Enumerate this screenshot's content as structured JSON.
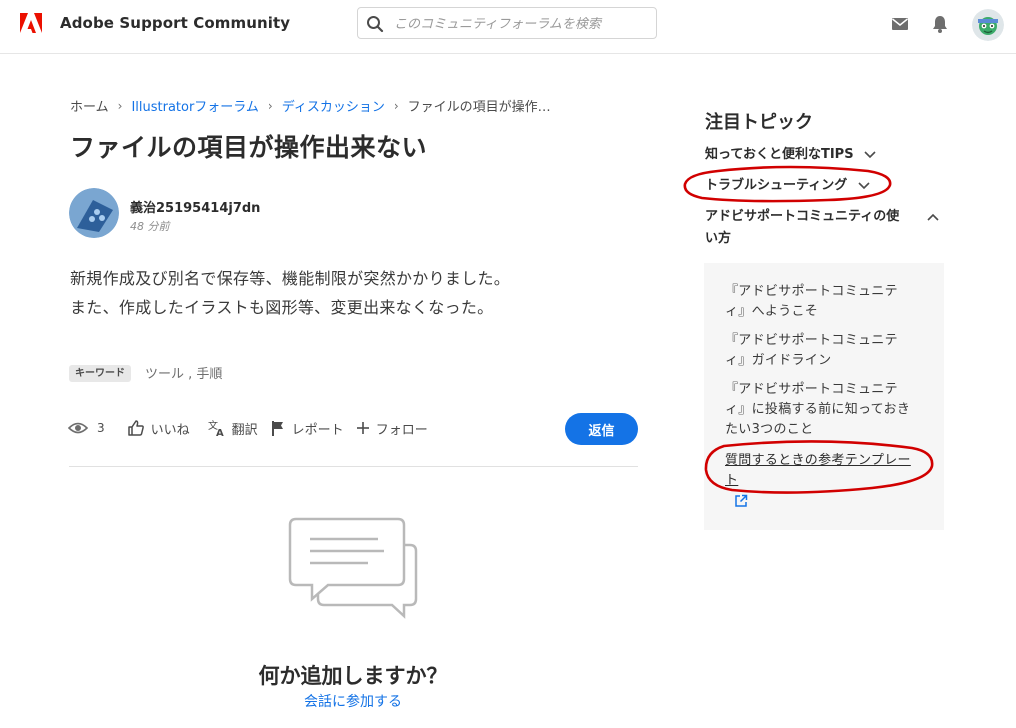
{
  "header": {
    "brand": "Adobe Support Community",
    "search_placeholder": "このコミュニティフォーラムを検索"
  },
  "breadcrumb": [
    {
      "label": "ホーム"
    },
    {
      "label": "Illustratorフォーラム"
    },
    {
      "label": "ディスカッション"
    },
    {
      "label": "ファイルの項目が操作…"
    }
  ],
  "post": {
    "title": "ファイルの項目が操作出来ない",
    "author": "義治25195414j7dn",
    "time": "48 分前",
    "body": [
      "新規作成及び別名で保存等、機能制限が突然かかりました。",
      "また、作成したイラストも図形等、変更出来なくなった。"
    ],
    "keyword_label": "キーワード",
    "keywords": "ツール , 手順",
    "views": "3",
    "like_label": "いいね",
    "translate_label": "翻訳",
    "report_label": "レポート",
    "follow_label": "フォロー",
    "reply_label": "返信"
  },
  "empty_state": {
    "title": "何か追加しますか？",
    "link": "会話に参加する"
  },
  "sidebar": {
    "title": "注目トピック",
    "sections": [
      {
        "label": "知っておくと便利なTIPS"
      },
      {
        "label": "トラブルシューティング"
      },
      {
        "label_line1": "アドビサポートコミュニティの使",
        "label_line2": "い方"
      }
    ],
    "links": [
      {
        "line1": "『アドビサポートコミュニテ",
        "line2": "ィ』へようこそ"
      },
      {
        "line1": "『アドビサポートコミュニテ",
        "line2": "ィ』ガイドライン"
      },
      {
        "line1": "『アドビサポートコミュニテ",
        "line2": "ィ』に投稿する前に知っておき",
        "line3": "たい3つのこと"
      },
      {
        "line1": "質問するときの参考テンプレー",
        "line2": "ト"
      }
    ]
  },
  "colors": {
    "accent": "#1473e6",
    "adobe_red": "#eb1000",
    "annotation_red": "#d10000"
  }
}
